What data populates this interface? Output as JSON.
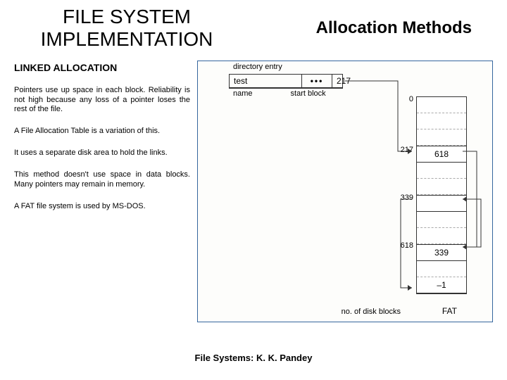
{
  "header": {
    "title_left": "FILE SYSTEM IMPLEMENTATION",
    "title_right": "Allocation Methods"
  },
  "subheading": "LINKED ALLOCATION",
  "paragraphs": {
    "p1": "Pointers use up space in each block. Reliability is not high because any loss of a pointer loses the rest of the file.",
    "p2": "A File Allocation Table is a variation of this.",
    "p3": "It uses a separate disk area to hold the links.",
    "p4": "This method doesn't use space in data blocks. Many pointers may remain in memory.",
    "p5": "A FAT file system is used by MS-DOS."
  },
  "diagram": {
    "dir_caption": "directory entry",
    "dir_name_val": "test",
    "dir_dots": "•••",
    "dir_start_val": "217",
    "dir_name_label": "name",
    "dir_start_label": "start block",
    "fat_idx_top": "0",
    "fat_idx_217": "217",
    "fat_val_217": "618",
    "fat_idx_339": "339",
    "fat_val_339": "",
    "fat_idx_618": "618",
    "fat_val_618": "339",
    "fat_val_last": "–1",
    "fat_count_label": "no. of disk blocks",
    "fat_title": "FAT"
  },
  "footer": "File Systems: K. K. Pandey"
}
